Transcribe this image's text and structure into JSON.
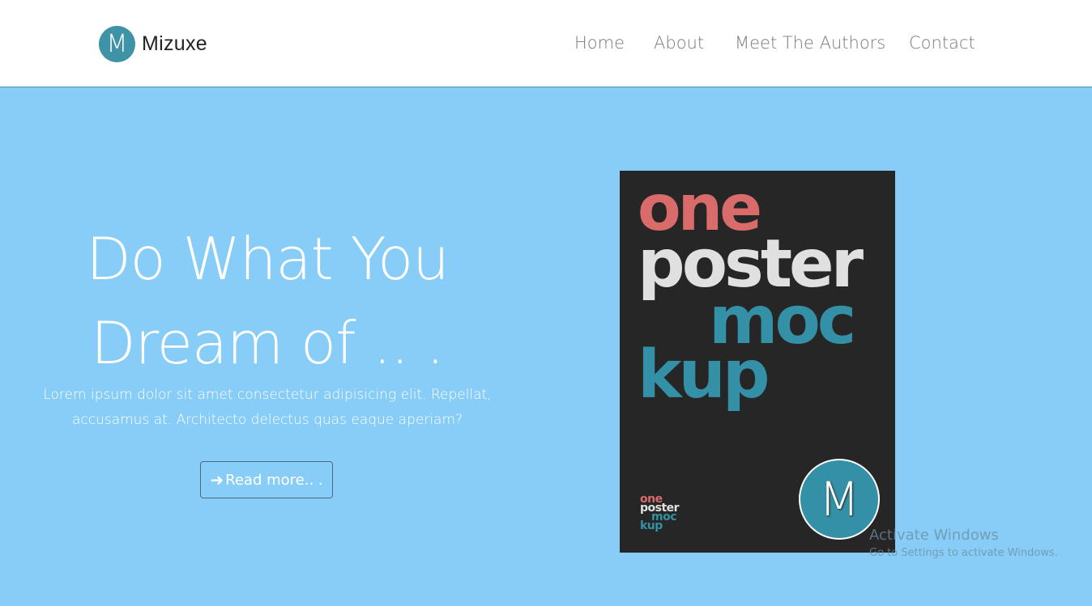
{
  "brand": {
    "logo_letter": "M",
    "name": "Mizuxe"
  },
  "nav": {
    "items": [
      {
        "label": "Home"
      },
      {
        "label": "About"
      },
      {
        "label": "Meet The Authors"
      },
      {
        "label": "Contact"
      }
    ]
  },
  "hero": {
    "title_line1": "Do What You",
    "title_line2": "Dream of .. .",
    "text_line1": "Lorem ipsum dolor sit amet consectetur adipisicing elit. Repellat,",
    "text_line2": "accusamus at. Architecto delectus quas eaque aperiam?",
    "button_icon": "arrow-right-icon",
    "button_label": "Read more.. ."
  },
  "poster": {
    "words": [
      "one",
      "poster",
      "moc",
      "kup"
    ],
    "small_words": [
      "one",
      "poster",
      "moc",
      "kup"
    ],
    "badge_letter": "M",
    "colors": {
      "background": "#262626",
      "one": "#d96b6b",
      "poster": "#e0e0e0",
      "mockup": "#3390a6"
    }
  },
  "watermark": {
    "title": "Activate Windows",
    "subtitle": "Go to Settings to activate Windows."
  },
  "colors": {
    "hero_bg": "#87cdf8",
    "brand_accent": "#3f93a6",
    "nav_text": "#7a7a7a"
  }
}
